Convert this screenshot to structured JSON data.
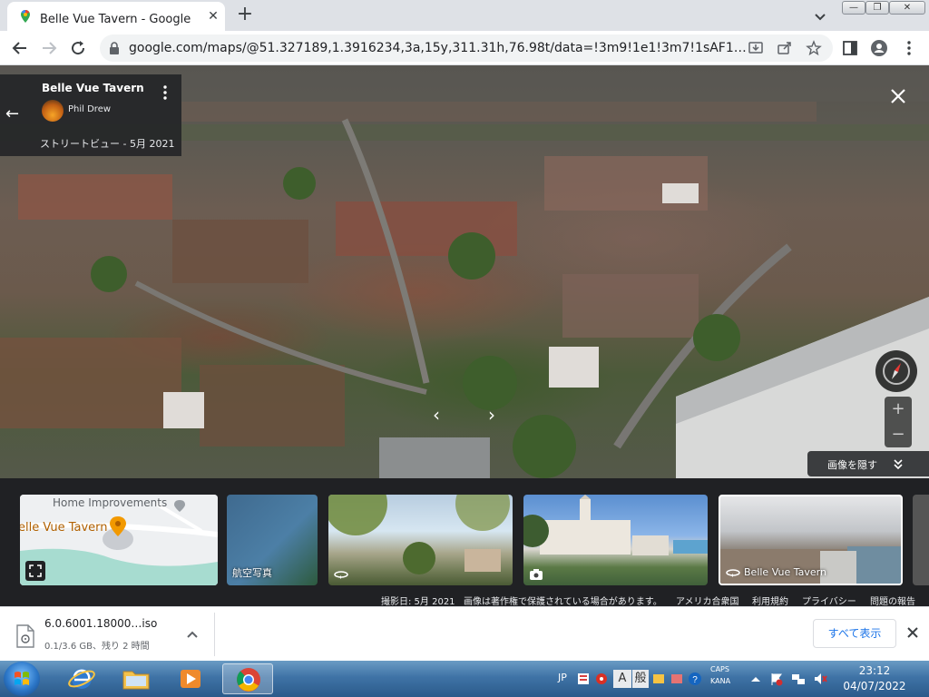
{
  "browser": {
    "tab_title": "Belle Vue Tavern - Google マップ",
    "tab_close": "✕",
    "new_tab": "+",
    "url": "google.com/maps/@51.327189,1.3916234,3a,15y,311.31h,76.98t/data=!3m9!1e1!3m7!1sAF1…",
    "window_buttons": [
      "—",
      "❐",
      "✕"
    ]
  },
  "viewer": {
    "back": "←",
    "place_name": "Belle Vue Tavern",
    "author": "Phil Drew",
    "capture_info": "ストリートビュー - 5月 2021",
    "zoom_in": "+",
    "zoom_out": "−",
    "prev": "‹",
    "next": "›",
    "hide_images": "画像を隠す"
  },
  "thumbnails": {
    "map_business": "Home Improvements",
    "map_place": "elle Vue Tavern",
    "aerial": "航空写真",
    "selected": "Belle Vue Tavern"
  },
  "footer": {
    "capture_date": "撮影日: 5月 2021",
    "copyright": "画像は著作権で保護されている場合があります。",
    "country": "アメリカ合衆国",
    "terms": "利用規約",
    "privacy": "プライバシー",
    "report": "問題の報告"
  },
  "download": {
    "file_name": "6.0.6001.18000…iso",
    "progress_text": "0.1/3.6 GB、残り 2 時間",
    "show_all": "すべて表示"
  },
  "taskbar": {
    "lang": "JP",
    "ime": "般",
    "caps": "CAPS",
    "kana": "KANA",
    "time": "23:12",
    "date": "04/07/2022"
  },
  "colors": {
    "accent": "#1a73e8",
    "viewer_panel": "#202124",
    "taskbar": "#3f73a6"
  }
}
